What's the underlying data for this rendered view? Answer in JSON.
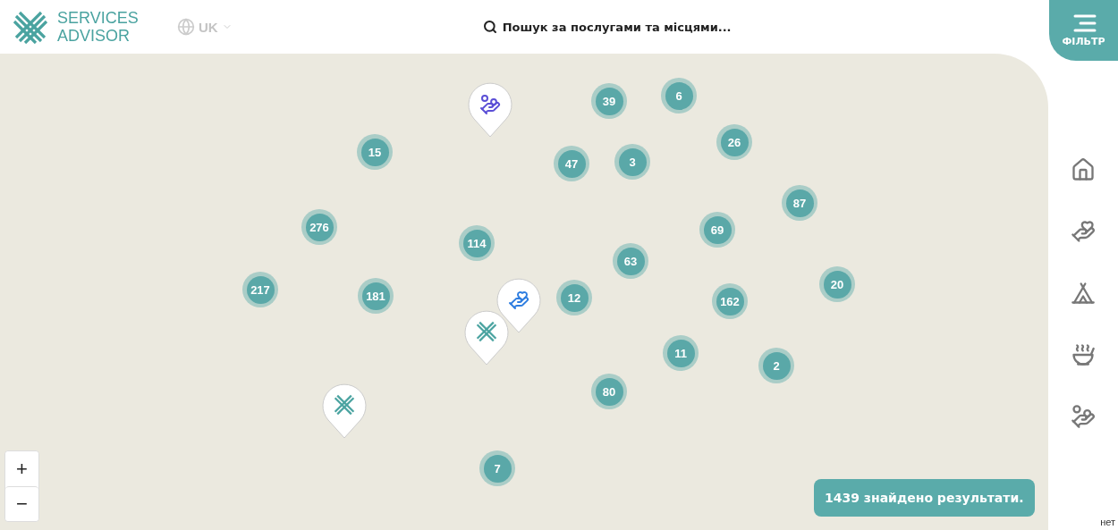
{
  "header": {
    "logo": {
      "line_1": "SERVICES",
      "line_2": "ADVISOR"
    },
    "language": "UK",
    "search": {
      "placeholder": "Пошук за послугами та місцями..."
    },
    "filter_button": "ФІЛЬТР"
  },
  "map": {
    "clusters": [
      {
        "count": "39"
      },
      {
        "count": "6"
      },
      {
        "count": "15"
      },
      {
        "count": "47"
      },
      {
        "count": "3"
      },
      {
        "count": "26"
      },
      {
        "count": "87"
      },
      {
        "count": "276"
      },
      {
        "count": "114"
      },
      {
        "count": "69"
      },
      {
        "count": "63"
      },
      {
        "count": "217"
      },
      {
        "count": "181"
      },
      {
        "count": "12"
      },
      {
        "count": "162"
      },
      {
        "count": "20"
      },
      {
        "count": "11"
      },
      {
        "count": "2"
      },
      {
        "count": "80"
      },
      {
        "count": "7"
      }
    ],
    "markers": [
      {
        "kind": "donation"
      },
      {
        "kind": "support"
      },
      {
        "kind": "services"
      },
      {
        "kind": "services"
      }
    ],
    "zoom_controls": [
      "+",
      "−"
    ],
    "results": "1439 знайдено результати.",
    "attribution": "нет"
  },
  "categories": [
    {
      "kind": "shelter"
    },
    {
      "kind": "support"
    },
    {
      "kind": "housing"
    },
    {
      "kind": "food"
    },
    {
      "kind": "donation"
    }
  ]
}
